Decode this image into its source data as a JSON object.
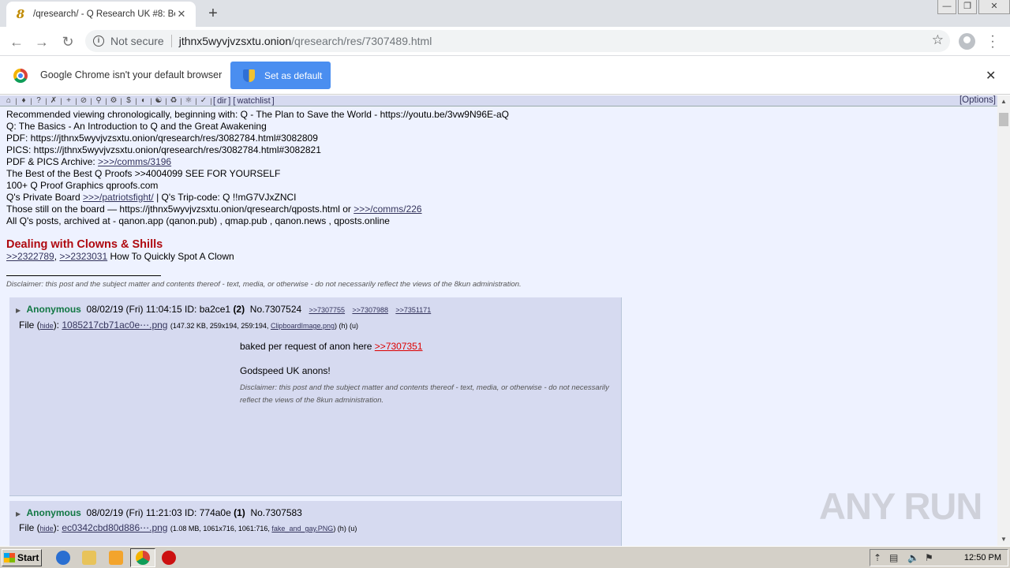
{
  "tab": {
    "title": "/qresearch/ - Q Research UK #8: Bo",
    "favicon": "8",
    "close": "✕"
  },
  "newtab": "+",
  "window_controls": {
    "minimize": "—",
    "restore": "❐",
    "close": "✕"
  },
  "address": {
    "not_secure": "Not secure",
    "host": "jthnx5wyvjvzsxtu.onion",
    "path": "/qresearch/res/7307489.html"
  },
  "infobar": {
    "message": "Google Chrome isn't your default browser",
    "button": "Set as default",
    "close": "✕"
  },
  "boardbar": {
    "dir": "dir",
    "watchlist": "watchlist",
    "options": "[Options]"
  },
  "op": {
    "line1": "Recommended viewing chronologically, beginning with: Q - The Plan to Save the World - https://youtu.be/3vw9N96E-aQ",
    "line2": "Q: The Basics - An Introduction to Q and the Great Awakening",
    "line3": "PDF: https://jthnx5wyvjvzsxtu.onion/qresearch/res/3082784.html#3082809",
    "line4": "PICS: https://jthnx5wyvjvzsxtu.onion/qresearch/res/3082784.html#3082821",
    "line5_label": "PDF & PICS Archive: ",
    "line5_link": ">>>/comms/3196",
    "line6": "The Best of the Best Q Proofs >>4004099 SEE FOR YOURSELF",
    "line7": "100+ Q Proof Graphics qproofs.com",
    "line8_label": "Q's Private Board ",
    "line8_link": ">>>/patriotsfight/",
    "line8_rest": " | Q's Trip-code: Q !!mG7VJxZNCI",
    "line9_label": "Those still on the board — https://jthnx5wyvjvzsxtu.onion/qresearch/qposts.html or ",
    "line9_link": ">>>/comms/226",
    "line10": "All Q's posts, archived at - qanon.app (qanon.pub) , qmap.pub , qanon.news , qposts.online",
    "heading": "Dealing with Clowns & Shills",
    "clown_link1": ">>2322789",
    "clown_sep": ", ",
    "clown_link2": ">>2323031",
    "clown_rest": " How To Quickly Spot A Clown",
    "disclaimer": "Disclaimer: this post and the subject matter and contents thereof - text, media, or otherwise - do not necessarily reflect the views of the 8kun administration."
  },
  "replies": [
    {
      "name": "Anonymous",
      "date": "08/02/19 (Fri) 11:04:15",
      "id_label": "ID: ",
      "id": "ba2ce1",
      "id_count": "(2)",
      "no": "No.7307524",
      "backlinks": [
        ">>7307755",
        ">>7307988",
        ">>7351171"
      ],
      "file_label": "File (",
      "hide": "hide",
      "file_label_end": "): ",
      "file_name": "1085217cb71ac0e⋯.png",
      "file_info": "(147.32 KB, 259x194, 259:194, ",
      "orig_name": "ClipboardImage.png",
      "file_tail": ") (h) (u)",
      "body_text": "baked per request of anon here  ",
      "body_link": ">>7307351",
      "body_line2": "Godspeed UK anons!",
      "disclaimer": "Disclaimer: this post and the subject matter and contents thereof - text, media, or otherwise - do not necessarily reflect the views of the 8kun administration."
    },
    {
      "name": "Anonymous",
      "date": "08/02/19 (Fri) 11:21:03",
      "id_label": "ID: ",
      "id": "774a0e",
      "id_count": "(1)",
      "no": "No.7307583",
      "file_label": "File (",
      "hide": "hide",
      "file_label_end": "): ",
      "file_name": "ec0342cbd80d886⋯.png",
      "file_info": "(1.08 MB, 1061x716, 1061:716, ",
      "orig_name": "fake_and_gay.PNG",
      "file_tail": ") (h) (u)"
    }
  ],
  "watermark": "ANY RUN",
  "taskbar": {
    "start": "Start",
    "clock": "12:50 PM"
  },
  "colors": {
    "accent_blue": "#4a8ef0",
    "name_green": "#117743",
    "heading_red": "#af0a0f",
    "reply_bg": "#d6daf0",
    "page_bg": "#eef2ff"
  },
  "icons": [
    "home-icon",
    "tag-icon",
    "question-icon",
    "shuffle-icon",
    "plus-icon",
    "ban-icon",
    "search-icon",
    "gear-icon",
    "dollar-icon",
    "contrast-icon",
    "twitter-icon",
    "recycle-icon",
    "bug-icon",
    "check-icon"
  ]
}
